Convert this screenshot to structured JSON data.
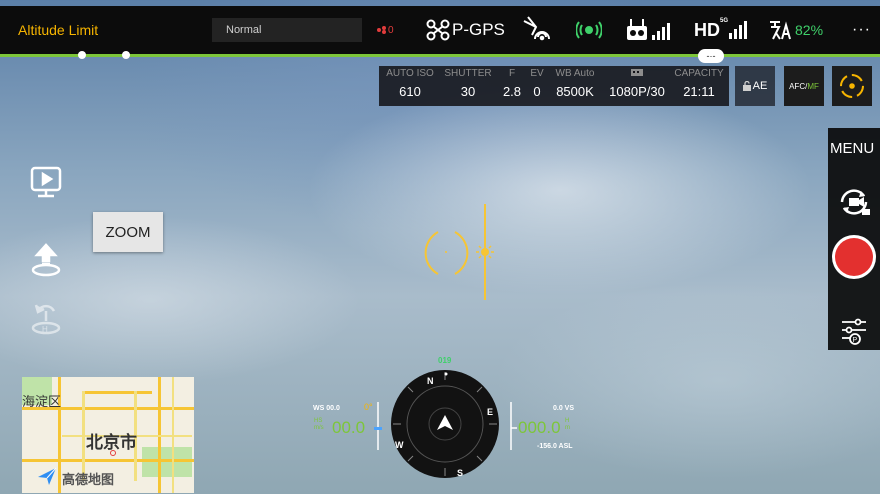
{
  "top_bar": {
    "altitude_limit": "Altitude Limit",
    "mode": "Normal",
    "warning_count": "0",
    "gps_label": "P-GPS",
    "hd_label": "HD",
    "hd_superscript": "5G",
    "battery_percent": "82%",
    "more": "···"
  },
  "drop_tab_glyph": "-·-",
  "camera_params": [
    {
      "label": "AUTO ISO",
      "value": "610"
    },
    {
      "label": "SHUTTER",
      "value": "30"
    },
    {
      "label": "F",
      "value": "2.8"
    },
    {
      "label": "EV",
      "value": "0"
    },
    {
      "label": "WB Auto",
      "value": "8500K"
    },
    {
      "label": "",
      "value": "1080P/30"
    },
    {
      "label": "CAPACITY",
      "value": "21:11"
    }
  ],
  "ae_label": "AE",
  "afc_label": "AFC/",
  "mf_label": "MF",
  "menu_label": "MENU",
  "zoom_label": "ZOOM",
  "map": {
    "district": "海淀区",
    "city": "北京市",
    "brand": "高德地图"
  },
  "telemetry": {
    "heading": "019",
    "wind_speed": "WS 00.0",
    "gimbal_angle": "0°",
    "horizontal_speed": "00.0",
    "vertical_speed": "0.0 VS",
    "altitude": "000.0",
    "asl": "-156.0 ASL",
    "compass": {
      "N": "N",
      "E": "E",
      "S": "S",
      "W": "W"
    }
  },
  "colors": {
    "accent_orange": "#f6b400",
    "accent_green": "#3fd06a",
    "record_red": "#e3302f",
    "bar_green": "#7dc63a"
  },
  "icons": [
    "drone-icon",
    "rc-signal-icon",
    "vision-icon",
    "remote-controller-icon",
    "battery-icon",
    "playback-icon",
    "takeoff-icon",
    "return-home-icon",
    "camera-switch-icon",
    "record-icon",
    "settings-icon",
    "focus-icon",
    "lock-icon"
  ]
}
